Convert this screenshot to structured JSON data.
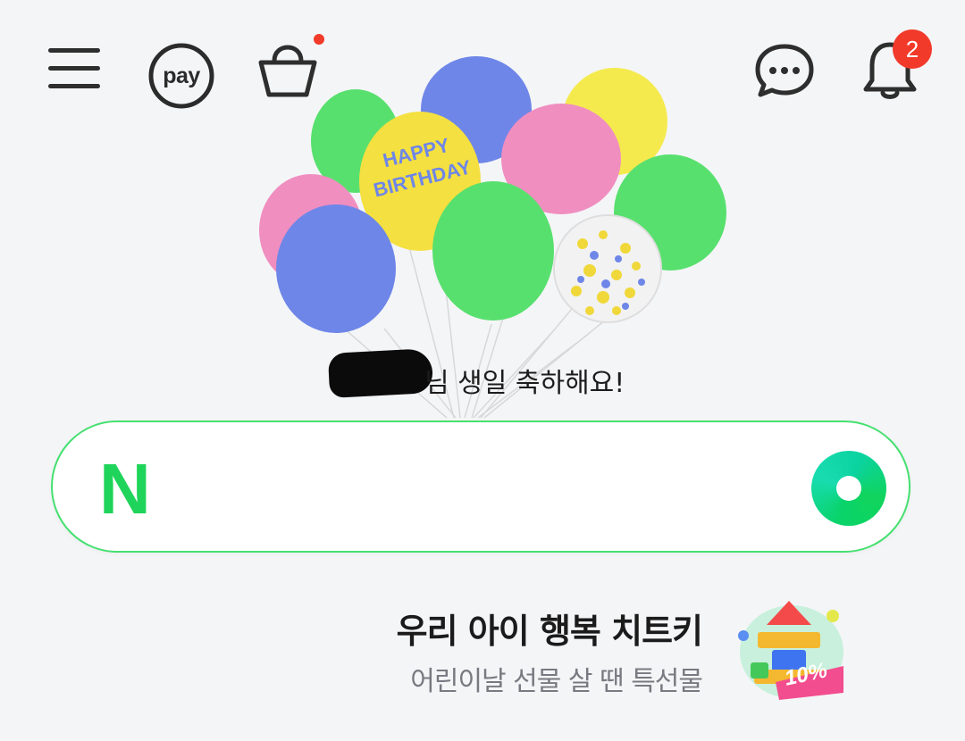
{
  "header": {
    "menu_icon": "hamburger-menu-icon",
    "pay_label": "pay",
    "shopping_icon": "shopping-bag-icon",
    "chat_icon": "chat-bubble-icon",
    "notification_icon": "bell-icon",
    "notification_count": "2"
  },
  "greeting": {
    "text": "님 생일 축하해요!"
  },
  "search": {
    "logo_letter": "N",
    "placeholder": "",
    "value": "",
    "lens_icon": "green-lens-icon"
  },
  "promo": {
    "title": "우리 아이 행복 치트키",
    "subtitle": "어린이날 선물 살 땐 특선물",
    "badge": "10%"
  },
  "colors": {
    "accent": "#1fd45a",
    "badge_red": "#f23a2a",
    "background": "#f4f5f7"
  }
}
